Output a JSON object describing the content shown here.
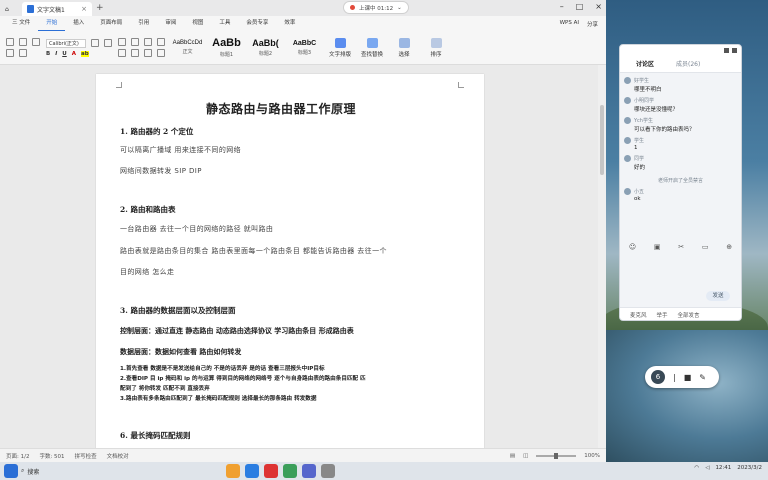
{
  "app": {
    "tab_title": "文字文稿1",
    "share_status": "上课中 01:12",
    "menu": [
      "三 文件",
      "开始",
      "插入",
      "页面布局",
      "引用",
      "审阅",
      "视图",
      "工具",
      "会员专享",
      "效率"
    ],
    "menu_active_index": 1,
    "menu_right": [
      "WPS AI",
      "分享"
    ],
    "font_name": "Calibri(正文)",
    "styles": [
      {
        "sample": "AaBbCcDd",
        "caption": "正文"
      },
      {
        "sample": "AaBb",
        "caption": "标题1"
      },
      {
        "sample": "AaBb(",
        "caption": "标题2"
      },
      {
        "sample": "AaBbC",
        "caption": "标题3"
      }
    ],
    "tools": [
      "文字排版",
      "查找替换",
      "选择",
      "排序"
    ]
  },
  "document": {
    "title": "静态路由与路由器工作原理",
    "sections": [
      {
        "heading": "1. 路由器的 2 个定位",
        "lines": [
          "可以隔离广播域  用来连接不同的网络",
          "网络间数据转发  SIP DIP"
        ]
      },
      {
        "heading": "2. 路由和路由表",
        "lines": [
          "一台路由器  去往一个目的网络的路径  就叫路由",
          "路由表就是路由条目的集合  路由表里面每一个路由条目  都能告诉路由器  去往一个",
          "目的网络  怎么走"
        ]
      },
      {
        "heading": "3. 路由器的数据层面以及控制层面",
        "lines": [
          "控制层面：通过直连  静态路由  动态路由选择协议  学习路由条目  形成路由表",
          "数据层面：数据如何查看  路由如何转发"
        ],
        "steps": [
          "1.首先查看  数据是不是发送给自己的  不是的话丢弃  是的话  查看三层报头中IP目标",
          "2.查看DIP  目 ip    掩码和 ip 的与运算  得到目的网络的网络号  逐个与自身路由表的路由条目匹配  匹",
          "配到了  将你转发    匹配不到  直接丢弃",
          "3.路由表有多条路由匹配到了  最长掩码匹配规则    选择最长的那条路由  转发数据"
        ]
      },
      {
        "heading": "6. 最长掩码匹配规则",
        "lines": []
      }
    ]
  },
  "status": {
    "page": "页面: 1/2",
    "words": "字数: 501",
    "spell": "拼写检查",
    "proof": "文档校对",
    "zoom": "100%"
  },
  "chat": {
    "tab_discussion": "讨论区",
    "tab_members": "成员(26)",
    "messages": [
      {
        "name": "好学生",
        "text": "哪里不明白"
      },
      {
        "name": "小明同学",
        "text": "哪块还是没懂呢？"
      },
      {
        "name": "Ych学生",
        "text": "可以看下你的路由表吗？"
      },
      {
        "name": "学生",
        "text": "1"
      },
      {
        "name": "同学",
        "text": "好的"
      }
    ],
    "system_notice": "老师开启了全员禁言",
    "messages2": [
      {
        "name": "小五",
        "text": "ok"
      }
    ],
    "send_label": "发送",
    "bottom_items": [
      "麦克风",
      "举手",
      "全部发言"
    ]
  },
  "pill": {
    "badge": "6"
  },
  "taskbar": {
    "time": "12:41",
    "date": "2023/3/2",
    "search_label": "搜索"
  },
  "colors": {
    "accent": "#2b6fd6",
    "chat_bg": "#f2f4f7"
  }
}
